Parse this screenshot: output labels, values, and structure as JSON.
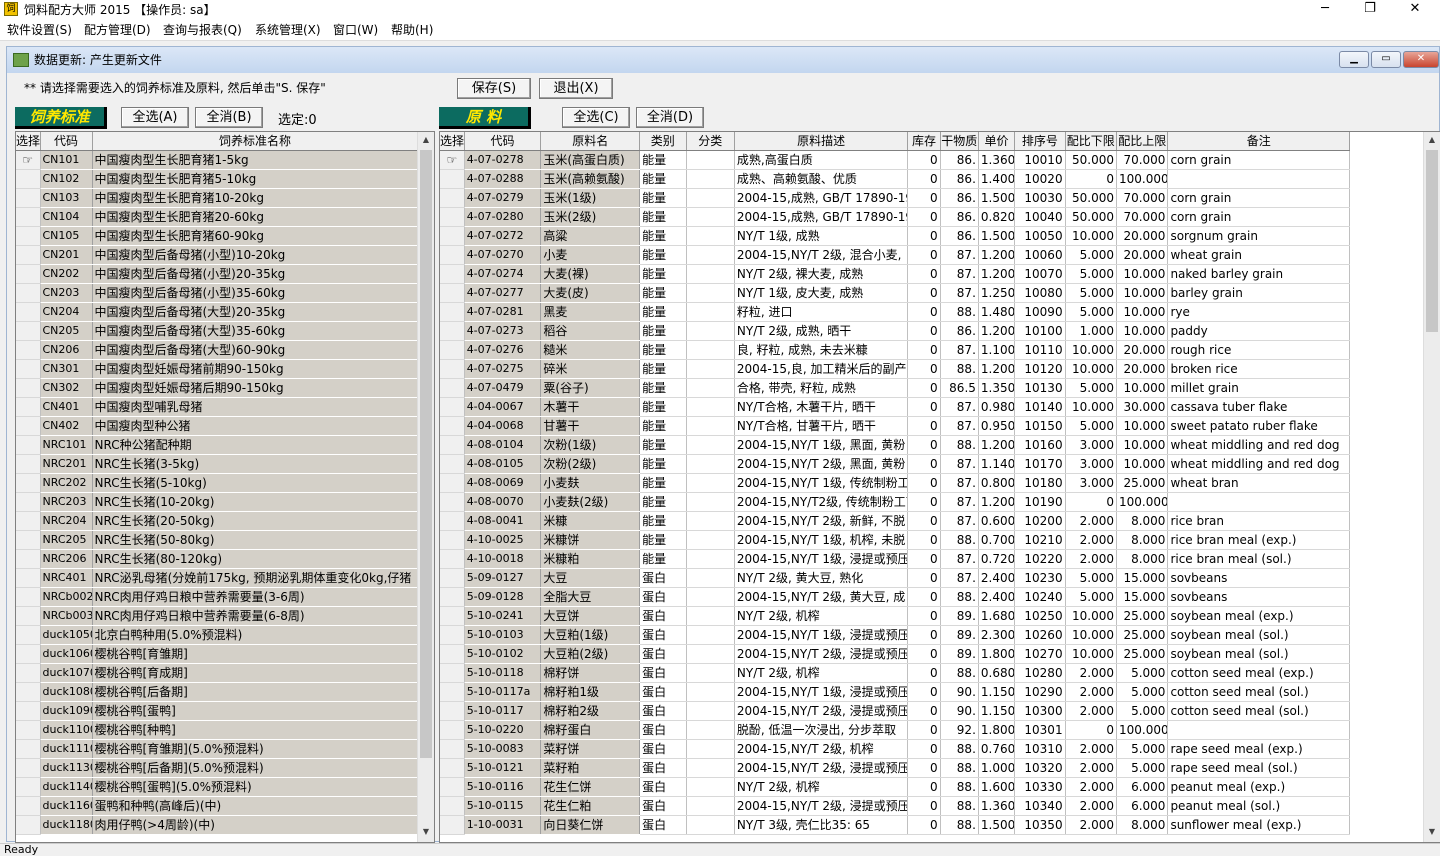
{
  "app": {
    "title": "饲料配方大师 2015 【操作员: sa】",
    "window_buttons": [
      "─",
      "❐",
      "✕"
    ]
  },
  "menu": [
    "软件设置(S)",
    "配方管理(D)",
    "查询与报表(Q)",
    "系统管理(X)",
    "窗口(W)",
    "帮助(H)"
  ],
  "child": {
    "title": "数据更新: 产生更新文件",
    "hint": "** 请选择需要选入的饲养标准及原料, 然后单击\"S. 保存\"",
    "save": "保存(S)",
    "exit": "退出(X)"
  },
  "left": {
    "section": "饲养标准",
    "select_all": "全选(A)",
    "deselect_all": "全消(B)",
    "selected": "选定:0",
    "columns": [
      "选择",
      "代码",
      "饲养标准名称"
    ],
    "rows": [
      [
        "CN101",
        "中国瘦肉型生长肥育猪1-5kg"
      ],
      [
        "CN102",
        "中国瘦肉型生长肥育猪5-10kg"
      ],
      [
        "CN103",
        "中国瘦肉型生长肥育猪10-20kg"
      ],
      [
        "CN104",
        "中国瘦肉型生长肥育猪20-60kg"
      ],
      [
        "CN105",
        "中国瘦肉型生长肥育猪60-90kg"
      ],
      [
        "CN201",
        "中国瘦肉型后备母猪(小型)10-20kg"
      ],
      [
        "CN202",
        "中国瘦肉型后备母猪(小型)20-35kg"
      ],
      [
        "CN203",
        "中国瘦肉型后备母猪(小型)35-60kg"
      ],
      [
        "CN204",
        "中国瘦肉型后备母猪(大型)20-35kg"
      ],
      [
        "CN205",
        "中国瘦肉型后备母猪(大型)35-60kg"
      ],
      [
        "CN206",
        "中国瘦肉型后备母猪(大型)60-90kg"
      ],
      [
        "CN301",
        "中国瘦肉型妊娠母猪前期90-150kg"
      ],
      [
        "CN302",
        "中国瘦肉型妊娠母猪后期90-150kg"
      ],
      [
        "CN401",
        "中国瘦肉型哺乳母猪"
      ],
      [
        "CN402",
        "中国瘦肉型种公猪"
      ],
      [
        "NRC101",
        "NRC种公猪配种期"
      ],
      [
        "NRC201",
        "NRC生长猪(3-5kg)"
      ],
      [
        "NRC202",
        "NRC生长猪(5-10kg)"
      ],
      [
        "NRC203",
        "NRC生长猪(10-20kg)"
      ],
      [
        "NRC204",
        "NRC生长猪(20-50kg)"
      ],
      [
        "NRC205",
        "NRC生长猪(50-80kg)"
      ],
      [
        "NRC206",
        "NRC生长猪(80-120kg)"
      ],
      [
        "NRC401",
        "NRC泌乳母猪(分娩前175kg, 预期泌乳期体重变化0kg,仔猪"
      ],
      [
        "NRCb002",
        "NRC肉用仔鸡日粮中营养需要量(3-6周)"
      ],
      [
        "NRCb003",
        "NRC肉用仔鸡日粮中营养需要量(6-8周)"
      ],
      [
        "duck1050",
        "北京白鸭种用(5.0%预混料)"
      ],
      [
        "duck1060",
        "樱桃谷鸭[育雏期]"
      ],
      [
        "duck1070",
        "樱桃谷鸭[育成期]"
      ],
      [
        "duck1080",
        "樱桃谷鸭[后备期]"
      ],
      [
        "duck1090",
        "樱桃谷鸭[蛋鸭]"
      ],
      [
        "duck1100",
        "樱桃谷鸭[种鸭]"
      ],
      [
        "duck1110",
        "樱桃谷鸭[育雏期](5.0%预混料)"
      ],
      [
        "duck1130",
        "樱桃谷鸭[后备期](5.0%预混料)"
      ],
      [
        "duck1140",
        "樱桃谷鸭[蛋鸭](5.0%预混料)"
      ],
      [
        "duck1160",
        "蛋鸭和种鸭(高峰后)(中)"
      ],
      [
        "duck1180",
        "肉用仔鸭(>4周龄)(中)"
      ]
    ]
  },
  "right": {
    "section": "原 料",
    "select_all": "全选(C)",
    "deselect_all": "全消(D)",
    "columns": [
      "选择",
      "代码",
      "原料名",
      "类别",
      "分类",
      "原料描述",
      "库存",
      "干物质",
      "单价",
      "排序号",
      "配比下限",
      "配比上限",
      "备注"
    ],
    "rows": [
      [
        "4-07-0278",
        "玉米(高蛋白质)",
        "能量",
        "",
        "成熟,高蛋白质",
        "0",
        "86.",
        "1.360",
        "10010",
        "50.000",
        "70.000",
        "corn grain"
      ],
      [
        "4-07-0288",
        "玉米(高赖氨酸)",
        "能量",
        "",
        "成熟、高赖氨酸、优质",
        "0",
        "86.",
        "1.400",
        "10020",
        "0",
        "100.000",
        ""
      ],
      [
        "4-07-0279",
        "玉米(1级)",
        "能量",
        "",
        "2004-15,成熟, GB/T 17890-19",
        "0",
        "86.",
        "1.500",
        "10030",
        "50.000",
        "70.000",
        "corn grain"
      ],
      [
        "4-07-0280",
        "玉米(2级)",
        "能量",
        "",
        "2004-15,成熟, GB/T 17890-19",
        "0",
        "86.",
        "0.820",
        "10040",
        "50.000",
        "70.000",
        "corn grain"
      ],
      [
        "4-07-0272",
        "高粱",
        "能量",
        "",
        "NY/T 1级, 成熟",
        "0",
        "86.",
        "1.500",
        "10050",
        "10.000",
        "20.000",
        "sorgnum grain"
      ],
      [
        "4-07-0270",
        "小麦",
        "能量",
        "",
        "2004-15,NY/T 2级, 混合小麦,",
        "0",
        "87.",
        "1.200",
        "10060",
        "5.000",
        "20.000",
        "wheat grain"
      ],
      [
        "4-07-0274",
        "大麦(裸)",
        "能量",
        "",
        "NY/T 2级, 裸大麦, 成熟",
        "0",
        "87.",
        "1.200",
        "10070",
        "5.000",
        "10.000",
        "naked barley grain"
      ],
      [
        "4-07-0277",
        "大麦(皮)",
        "能量",
        "",
        "NY/T 1级, 皮大麦, 成熟",
        "0",
        "87.",
        "1.250",
        "10080",
        "5.000",
        "10.000",
        "barley grain"
      ],
      [
        "4-07-0281",
        "黑麦",
        "能量",
        "",
        "籽粒, 进口",
        "0",
        "88.",
        "1.480",
        "10090",
        "5.000",
        "10.000",
        "rye"
      ],
      [
        "4-07-0273",
        "稻谷",
        "能量",
        "",
        "NY/T 2级, 成熟, 晒干",
        "0",
        "86.",
        "1.200",
        "10100",
        "1.000",
        "10.000",
        "paddy"
      ],
      [
        "4-07-0276",
        "糙米",
        "能量",
        "",
        "良, 籽粒, 成熟, 未去米糠",
        "0",
        "87.",
        "1.100",
        "10110",
        "10.000",
        "20.000",
        "rough rice"
      ],
      [
        "4-07-0275",
        "碎米",
        "能量",
        "",
        "2004-15,良, 加工精米后的副产",
        "0",
        "88.",
        "1.200",
        "10120",
        "10.000",
        "20.000",
        "broken rice"
      ],
      [
        "4-07-0479",
        "粟(谷子)",
        "能量",
        "",
        "合格, 带壳, 籽粒, 成熟",
        "0",
        "86.5",
        "1.350",
        "10130",
        "5.000",
        "10.000",
        "millet grain"
      ],
      [
        "4-04-0067",
        "木薯干",
        "能量",
        "",
        "NY/T合格, 木薯干片, 晒干",
        "0",
        "87.",
        "0.980",
        "10140",
        "10.000",
        "30.000",
        "cassava tuber flake"
      ],
      [
        "4-04-0068",
        "甘薯干",
        "能量",
        "",
        "NY/T合格, 甘薯干片, 晒干",
        "0",
        "87.",
        "0.950",
        "10150",
        "5.000",
        "10.000",
        "sweet patato ruber flake"
      ],
      [
        "4-08-0104",
        "次粉(1级)",
        "能量",
        "",
        "2004-15,NY/T 1级, 黑面, 黄粉",
        "0",
        "88.",
        "1.200",
        "10160",
        "3.000",
        "10.000",
        "wheat middling and red dog"
      ],
      [
        "4-08-0105",
        "次粉(2级)",
        "能量",
        "",
        "2004-15,NY/T 2级, 黑面, 黄粉",
        "0",
        "87.",
        "1.140",
        "10170",
        "3.000",
        "10.000",
        "wheat middling and red dog"
      ],
      [
        "4-08-0069",
        "小麦麸",
        "能量",
        "",
        "2004-15,NY/T 1级, 传统制粉工",
        "0",
        "87.",
        "0.800",
        "10180",
        "3.000",
        "25.000",
        "wheat bran"
      ],
      [
        "4-08-0070",
        "小麦麸(2级)",
        "能量",
        "",
        "2004-15,NY/T2级, 传统制粉工艺",
        "0",
        "87.",
        "1.200",
        "10190",
        "0",
        "100.000",
        ""
      ],
      [
        "4-08-0041",
        "米糠",
        "能量",
        "",
        "2004-15,NY/T 2级, 新鲜, 不脱",
        "0",
        "87.",
        "0.600",
        "10200",
        "2.000",
        "8.000",
        "rice bran"
      ],
      [
        "4-10-0025",
        "米糠饼",
        "能量",
        "",
        "2004-15,NY/T 1级, 机榨, 未脱",
        "0",
        "88.",
        "0.700",
        "10210",
        "2.000",
        "8.000",
        "rice bran meal (exp.)"
      ],
      [
        "4-10-0018",
        "米糠粕",
        "能量",
        "",
        "2004-15,NY/T 1级, 浸提或预压",
        "0",
        "87.",
        "0.720",
        "10220",
        "2.000",
        "8.000",
        "rice bran meal (sol.)"
      ],
      [
        "5-09-0127",
        "大豆",
        "蛋白",
        "",
        "NY/T 2级, 黄大豆, 熟化",
        "0",
        "87.",
        "2.400",
        "10230",
        "5.000",
        "15.000",
        "sovbeans"
      ],
      [
        "5-09-0128",
        "全脂大豆",
        "蛋白",
        "",
        "2004-15,NY/T 2级, 黄大豆, 成",
        "0",
        "88.",
        "2.400",
        "10240",
        "5.000",
        "15.000",
        "sovbeans"
      ],
      [
        "5-10-0241",
        "大豆饼",
        "蛋白",
        "",
        "NY/T 2级, 机榨",
        "0",
        "89.",
        "1.680",
        "10250",
        "10.000",
        "25.000",
        "soybean meal (exp.)"
      ],
      [
        "5-10-0103",
        "大豆粕(1级)",
        "蛋白",
        "",
        "2004-15,NY/T 1级, 浸提或预压",
        "0",
        "89.",
        "2.300",
        "10260",
        "10.000",
        "25.000",
        "soybean meal (sol.)"
      ],
      [
        "5-10-0102",
        "大豆粕(2级)",
        "蛋白",
        "",
        "2004-15,NY/T 2级, 浸提或预压",
        "0",
        "89.",
        "1.800",
        "10270",
        "10.000",
        "25.000",
        "soybean meal (sol.)"
      ],
      [
        "5-10-0118",
        "棉籽饼",
        "蛋白",
        "",
        "NY/T 2级, 机榨",
        "0",
        "88.",
        "0.680",
        "10280",
        "2.000",
        "5.000",
        "cotton seed meal (exp.)"
      ],
      [
        "5-10-0117a",
        "棉籽粕1级",
        "蛋白",
        "",
        "2004-15,NY/T 1级, 浸提或预压",
        "0",
        "90.",
        "1.150",
        "10290",
        "2.000",
        "5.000",
        "cotton seed meal (sol.)"
      ],
      [
        "5-10-0117",
        "棉籽粕2级",
        "蛋白",
        "",
        "2004-15,NY/T 2级, 浸提或预压",
        "0",
        "90.",
        "1.150",
        "10300",
        "2.000",
        "5.000",
        "cotton seed meal (sol.)"
      ],
      [
        "5-10-0220",
        "棉籽蛋白",
        "蛋白",
        "",
        "脱酚, 低温一次浸出, 分步萃取",
        "0",
        "92.",
        "1.800",
        "10301",
        "0",
        "100.000",
        ""
      ],
      [
        "5-10-0083",
        "菜籽饼",
        "蛋白",
        "",
        "2004-15,NY/T 2级, 机榨",
        "0",
        "88.",
        "0.760",
        "10310",
        "2.000",
        "5.000",
        "rape seed meal (exp.)"
      ],
      [
        "5-10-0121",
        "菜籽粕",
        "蛋白",
        "",
        "2004-15,NY/T 2级, 浸提或预压",
        "0",
        "88.",
        "1.000",
        "10320",
        "2.000",
        "5.000",
        "rape seed meal (sol.)"
      ],
      [
        "5-10-0116",
        "花生仁饼",
        "蛋白",
        "",
        "NY/T 2级, 机榨",
        "0",
        "88.",
        "1.600",
        "10330",
        "2.000",
        "6.000",
        "peanut meal (exp.)"
      ],
      [
        "5-10-0115",
        "花生仁粕",
        "蛋白",
        "",
        "2004-15,NY/T 2级, 浸提或预压",
        "0",
        "88.",
        "1.360",
        "10340",
        "2.000",
        "6.000",
        "peanut meal (sol.)"
      ],
      [
        "1-10-0031",
        "向日葵仁饼",
        "蛋白",
        "",
        "NY/T 3级, 壳仁比35: 65",
        "0",
        "88.",
        "1.500",
        "10350",
        "2.000",
        "8.000",
        "sunflower meal (exp.)"
      ]
    ]
  },
  "status": "Ready"
}
